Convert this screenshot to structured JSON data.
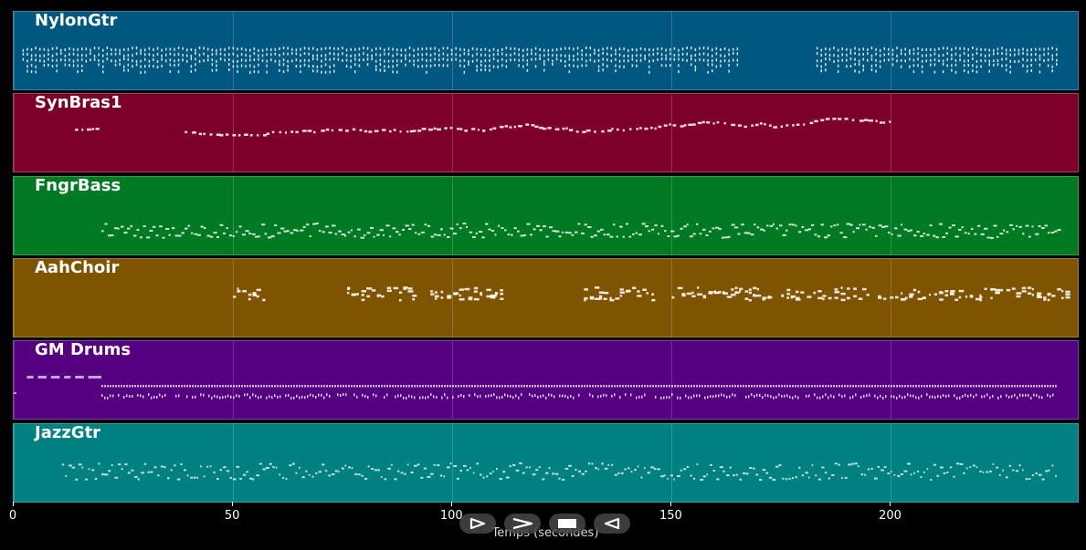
{
  "tracks": [
    {
      "name": "NylonGtr",
      "color": "#00577f",
      "pattern": "strum",
      "segments": [
        [
          2,
          165
        ],
        [
          183,
          238
        ]
      ]
    },
    {
      "name": "SynBras1",
      "color": "#7c0029",
      "pattern": "melody",
      "segments": [
        [
          14,
          19
        ],
        [
          39,
          200
        ]
      ]
    },
    {
      "name": "FngrBass",
      "color": "#007a22",
      "pattern": "bass",
      "segments": [
        [
          20,
          238
        ]
      ]
    },
    {
      "name": "AahChoir",
      "color": "#7f5400",
      "pattern": "choir",
      "segments": [
        [
          50,
          57
        ],
        [
          76,
          91
        ],
        [
          95,
          112
        ],
        [
          130,
          146
        ],
        [
          150,
          173
        ],
        [
          175,
          195
        ],
        [
          197,
          240
        ]
      ]
    },
    {
      "name": "GM Drums",
      "color": "#550080",
      "pattern": "drums",
      "segments": [
        [
          20,
          238
        ]
      ]
    },
    {
      "name": "JazzGtr",
      "color": "#008080",
      "pattern": "jazz",
      "segments": [
        [
          11,
          238
        ]
      ]
    }
  ],
  "x_axis": {
    "label": "Temps (secondes)",
    "range": [
      0,
      243
    ],
    "ticks": [
      0,
      50,
      100,
      150,
      200
    ]
  },
  "transport": [
    {
      "name": "play-icon",
      "symbol": "▷"
    },
    {
      "name": "fast-forward-icon",
      "symbol": ">"
    },
    {
      "name": "stop-icon",
      "symbol": "■"
    },
    {
      "name": "rewind-icon",
      "symbol": "◁"
    }
  ]
}
